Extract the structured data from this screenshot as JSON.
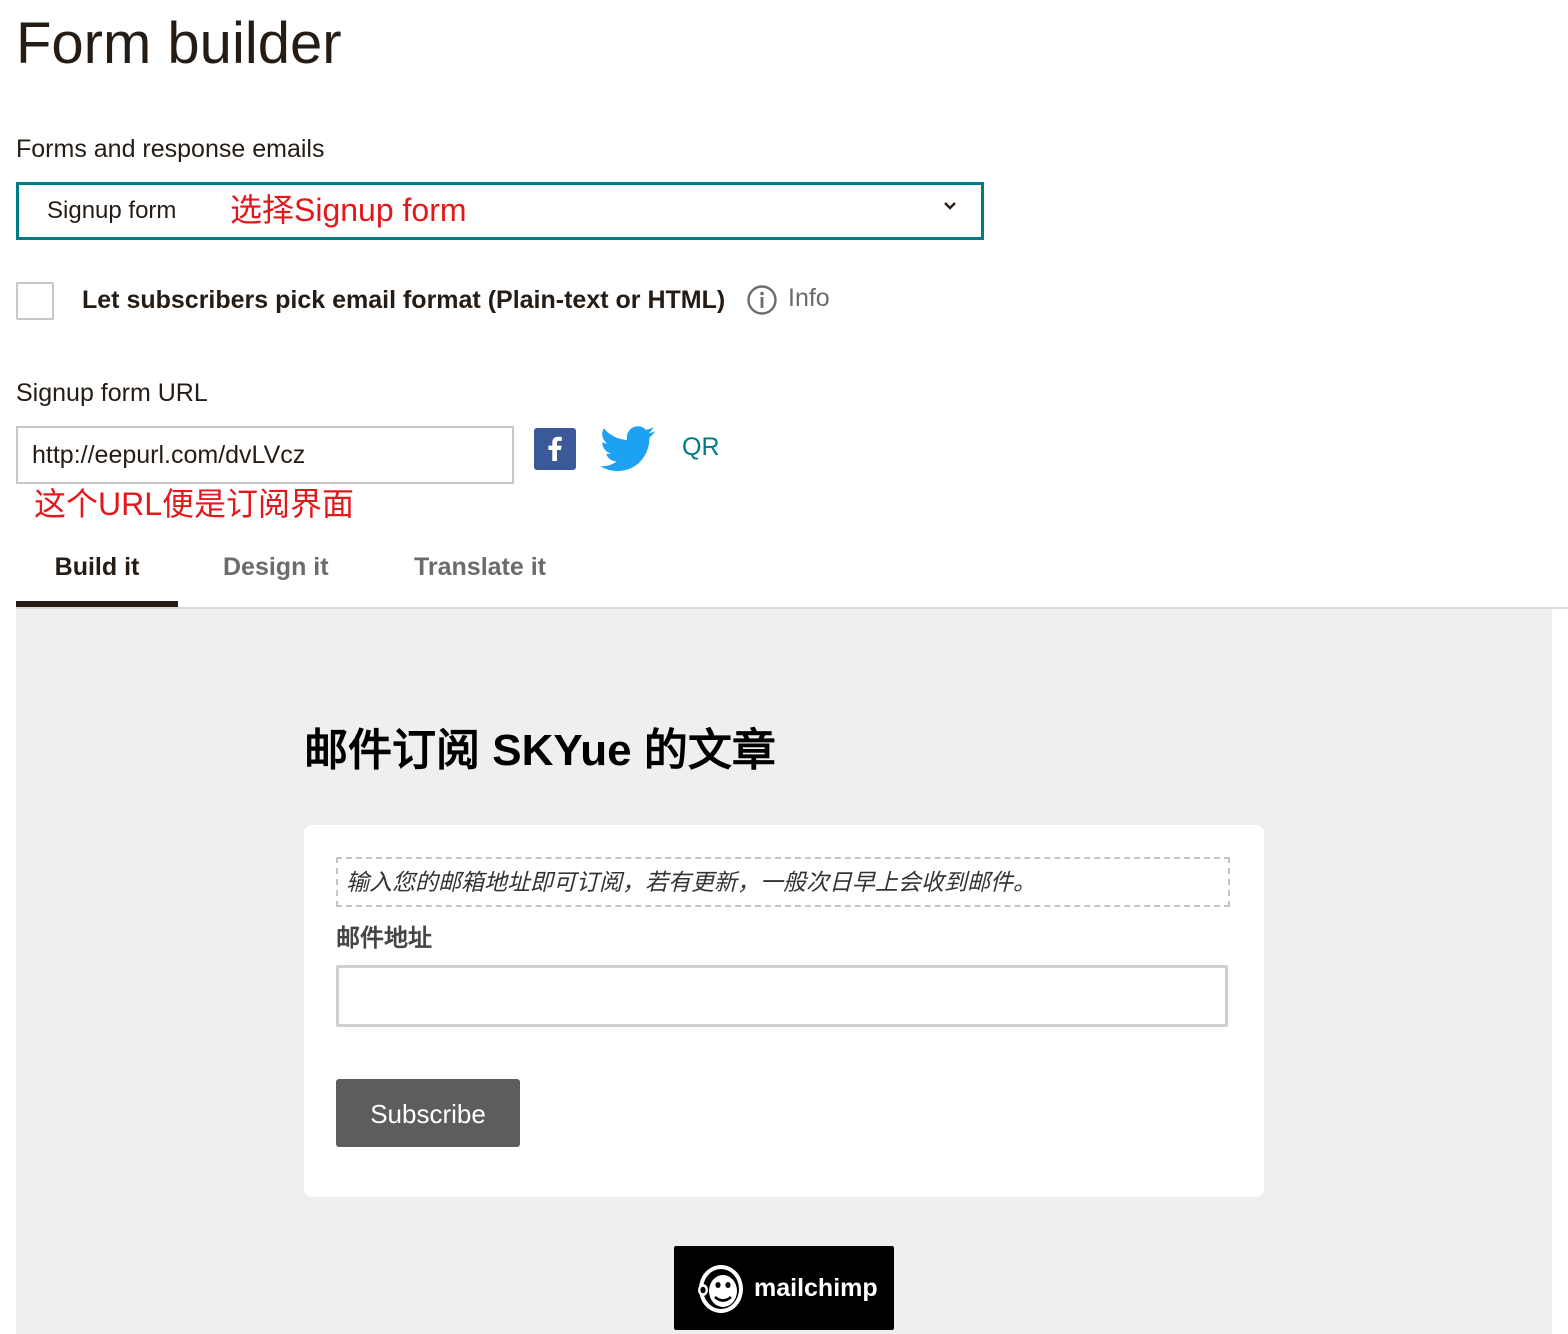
{
  "page": {
    "title": "Form builder"
  },
  "forms_section": {
    "label": "Forms and response emails",
    "select_value": "Signup form",
    "annotation": "选择Signup form"
  },
  "format_option": {
    "label": "Let subscribers pick email format (Plain-text or HTML)",
    "checked": false,
    "info_label": "Info"
  },
  "signup_url": {
    "label": "Signup form URL",
    "value": "http://eepurl.com/dvLVcz",
    "qr_label": "QR",
    "annotation": "这个URL便是订阅界面"
  },
  "tabs": [
    {
      "label": "Build it",
      "active": true
    },
    {
      "label": "Design it",
      "active": false
    },
    {
      "label": "Translate it",
      "active": false
    }
  ],
  "preview": {
    "title": "邮件订阅 SKYue 的文章",
    "intro": "输入您的邮箱地址即可订阅，若有更新，一般次日早上会收到邮件。",
    "email_label": "邮件地址",
    "email_value": "",
    "subscribe_label": "Subscribe",
    "badge_text": "mailchimp"
  },
  "colors": {
    "accent_teal": "#007c89",
    "annotation_red": "#e3181b",
    "facebook_blue": "#3b5998",
    "twitter_blue": "#1da1f2",
    "preview_bg": "#efefef",
    "subscribe_bg": "#5d5d5d"
  },
  "icons": {
    "select_chevron": "chevron-down-icon",
    "info": "info-circle-icon",
    "facebook": "facebook-icon",
    "twitter": "twitter-icon",
    "mailchimp": "mailchimp-freddie-icon"
  }
}
